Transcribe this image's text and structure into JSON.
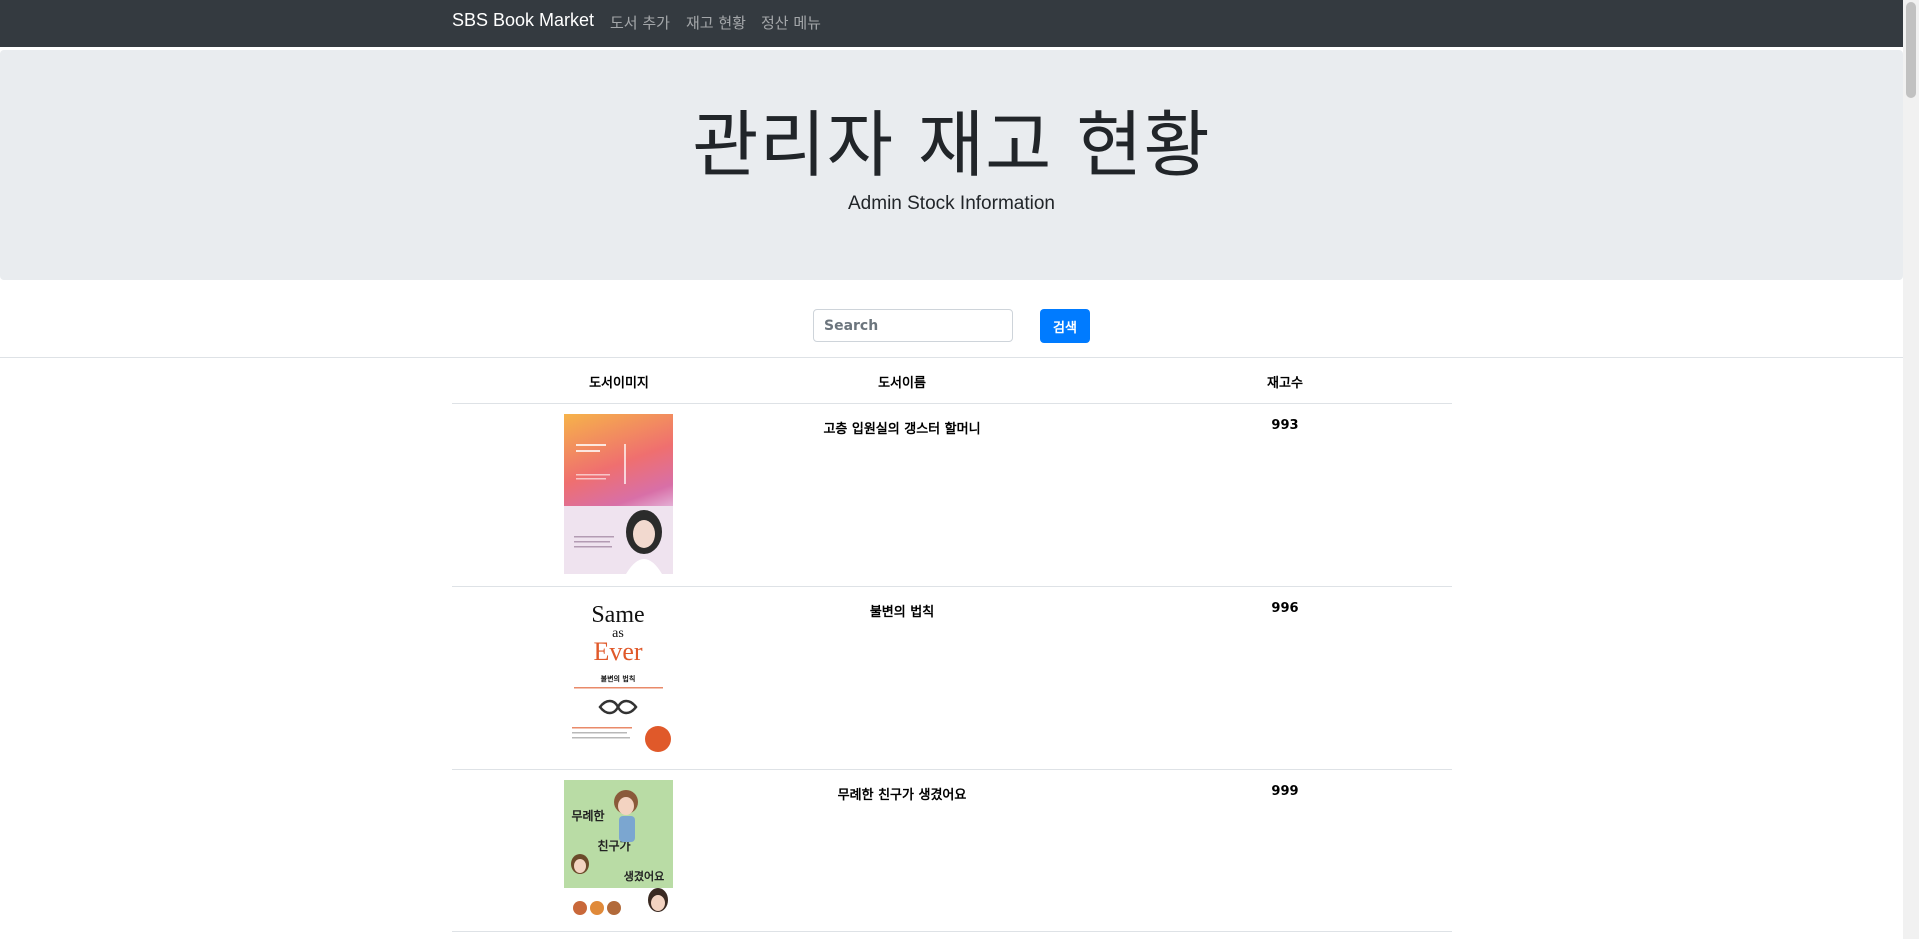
{
  "navbar": {
    "brand": "SBS Book Market",
    "links": [
      "도서 추가",
      "재고 현황",
      "정산 메뉴"
    ]
  },
  "jumbotron": {
    "title": "관리자 재고 현황",
    "subtitle": "Admin Stock Information"
  },
  "search": {
    "placeholder": "Search",
    "button_label": "검색"
  },
  "table": {
    "headers": [
      "도서이미지",
      "도서이름",
      "재고수"
    ],
    "rows": [
      {
        "name": "고층 입원실의 갱스터 할머니",
        "stock": "993"
      },
      {
        "name": "불변의 법칙",
        "stock": "996"
      },
      {
        "name": "무례한 친구가 생겼어요",
        "stock": "999"
      }
    ]
  },
  "covers": {
    "book2_title_line1": "Same",
    "book2_title_line2": "as",
    "book2_title_line3": "Ever",
    "book2_korean": "불변의 법칙",
    "book3_title_line1": "무례한",
    "book3_title_line2": "친구가",
    "book3_title_line3": "생겼어요",
    "book1_title": "고층 입원실의 갱스터 할머니"
  },
  "colors": {
    "navbar": "#343a40",
    "jumbotron": "#e9ecef",
    "primary": "#007bff"
  }
}
